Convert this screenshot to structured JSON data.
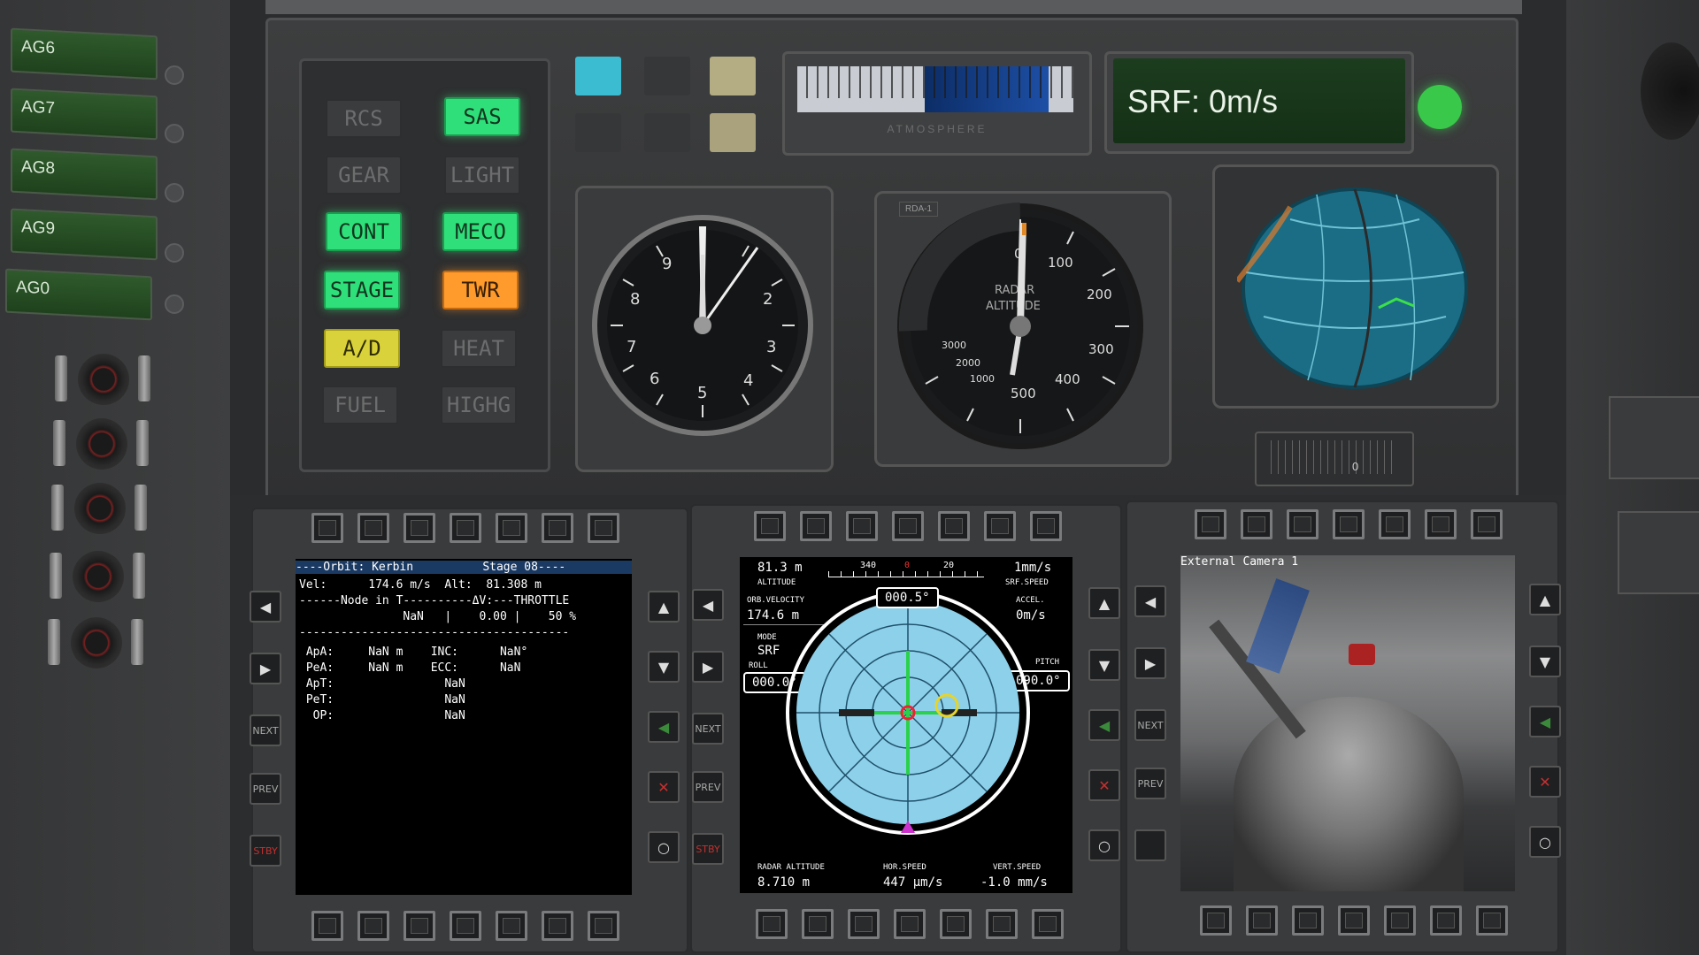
{
  "action_groups": [
    {
      "label": "AG6"
    },
    {
      "label": "AG7"
    },
    {
      "label": "AG8"
    },
    {
      "label": "AG9"
    },
    {
      "label": "AG0"
    }
  ],
  "indicators": {
    "rcs": "RCS",
    "sas": "SAS",
    "gear": "GEAR",
    "light": "LIGHT",
    "cont": "CONT",
    "meco": "MECO",
    "stage": "STAGE",
    "twr": "TWR",
    "ad": "A/D",
    "heat": "HEAT",
    "fuel": "FUEL",
    "highg": "HIGHG"
  },
  "atmosphere": {
    "label": "ATMOSPHERE",
    "level": 0.45
  },
  "speed_display": {
    "text": "SRF: 0m/s",
    "status_color": "#39c84a"
  },
  "clock": {
    "numbers": [
      "9",
      "8",
      "7",
      "6",
      "5",
      "4",
      "3",
      "2"
    ]
  },
  "radar_altimeter": {
    "tag": "RDA-1",
    "label_line1": "RADAR",
    "label_line2": "ALTITUDE",
    "scale": [
      "0",
      "100",
      "200",
      "300",
      "400",
      "500",
      "1000",
      "2000",
      "3000"
    ]
  },
  "nav_ball_scale": {
    "readout": "0"
  },
  "mfd_left": {
    "header": "----Orbit: Kerbin          Stage 08----",
    "line_vel": "Vel:      174.6 m/s  Alt:  81.308 m",
    "line_node": "------Node in T----------ΔV:---THROTTLE",
    "line_node_vals": "               NaN   |    0.00 |    50 %",
    "line_sep": "---------------------------------------",
    "line_apa": " ApA:     NaN m    INC:      NaN°",
    "line_pea": " PeA:     NaN m    ECC:      NaN",
    "line_apt": " ApT:                NaN",
    "line_pet": " PeT:                NaN",
    "line_op": "  OP:                NaN",
    "btn_next": "NEXT",
    "btn_prev": "PREV",
    "btn_stby": "STBY"
  },
  "mfd_center": {
    "altitude_val": "81.3 m",
    "altitude_lbl": "ALTITUDE",
    "srf_speed_val": "1mm/s",
    "srf_speed_lbl": "SRF.SPEED",
    "orb_velocity_lbl": "ORB.VELOCITY",
    "orb_velocity_val": "174.6 m",
    "accel_lbl": "ACCEL.",
    "accel_val": "0m/s",
    "mode_lbl": "MODE",
    "mode_val": "SRF",
    "roll_lbl": "ROLL",
    "roll_val": "000.0°",
    "pitch_lbl": "PITCH",
    "pitch_val": "090.0°",
    "heading_val": "000.5°",
    "heading_ticks": [
      "340",
      "0",
      "20"
    ],
    "radar_alt_lbl": "RADAR ALTITUDE",
    "radar_alt_val": "8.710 m",
    "hor_speed_lbl": "HOR.SPEED",
    "hor_speed_val": "447 μm/s",
    "vert_speed_lbl": "VERT.SPEED",
    "vert_speed_val": "-1.0 mm/s",
    "btn_next": "NEXT",
    "btn_prev": "PREV",
    "btn_stby": "STBY"
  },
  "mfd_right": {
    "camera_title": "External Camera 1",
    "btn_next": "NEXT",
    "btn_prev": "PREV"
  }
}
